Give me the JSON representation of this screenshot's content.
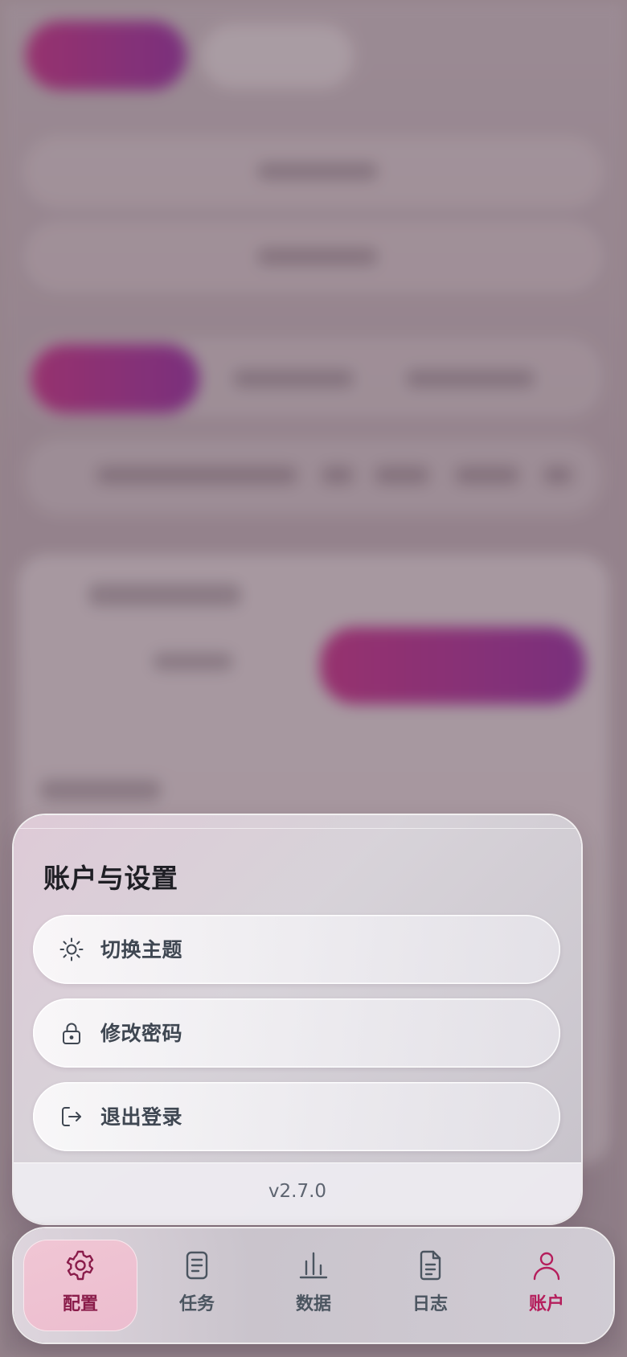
{
  "sheet": {
    "title": "账户与设置",
    "items": [
      {
        "label": "切换主题",
        "icon": "sun-icon"
      },
      {
        "label": "修改密码",
        "icon": "lock-icon"
      },
      {
        "label": "退出登录",
        "icon": "logout-icon"
      }
    ],
    "version": "v2.7.0"
  },
  "tabbar": {
    "tabs": [
      {
        "label": "配置",
        "icon": "gear-icon",
        "state": "selected"
      },
      {
        "label": "任务",
        "icon": "clipboard-icon"
      },
      {
        "label": "数据",
        "icon": "bar-chart-icon"
      },
      {
        "label": "日志",
        "icon": "document-icon"
      },
      {
        "label": "账户",
        "icon": "user-icon",
        "state": "highlighted"
      }
    ]
  },
  "colors": {
    "accent": "#b51e5c",
    "active_tab_bg": "#eec1d1",
    "active_tab_text": "#8a1c4a",
    "menu_text": "#3f4752",
    "title_text": "#1f1f25"
  }
}
